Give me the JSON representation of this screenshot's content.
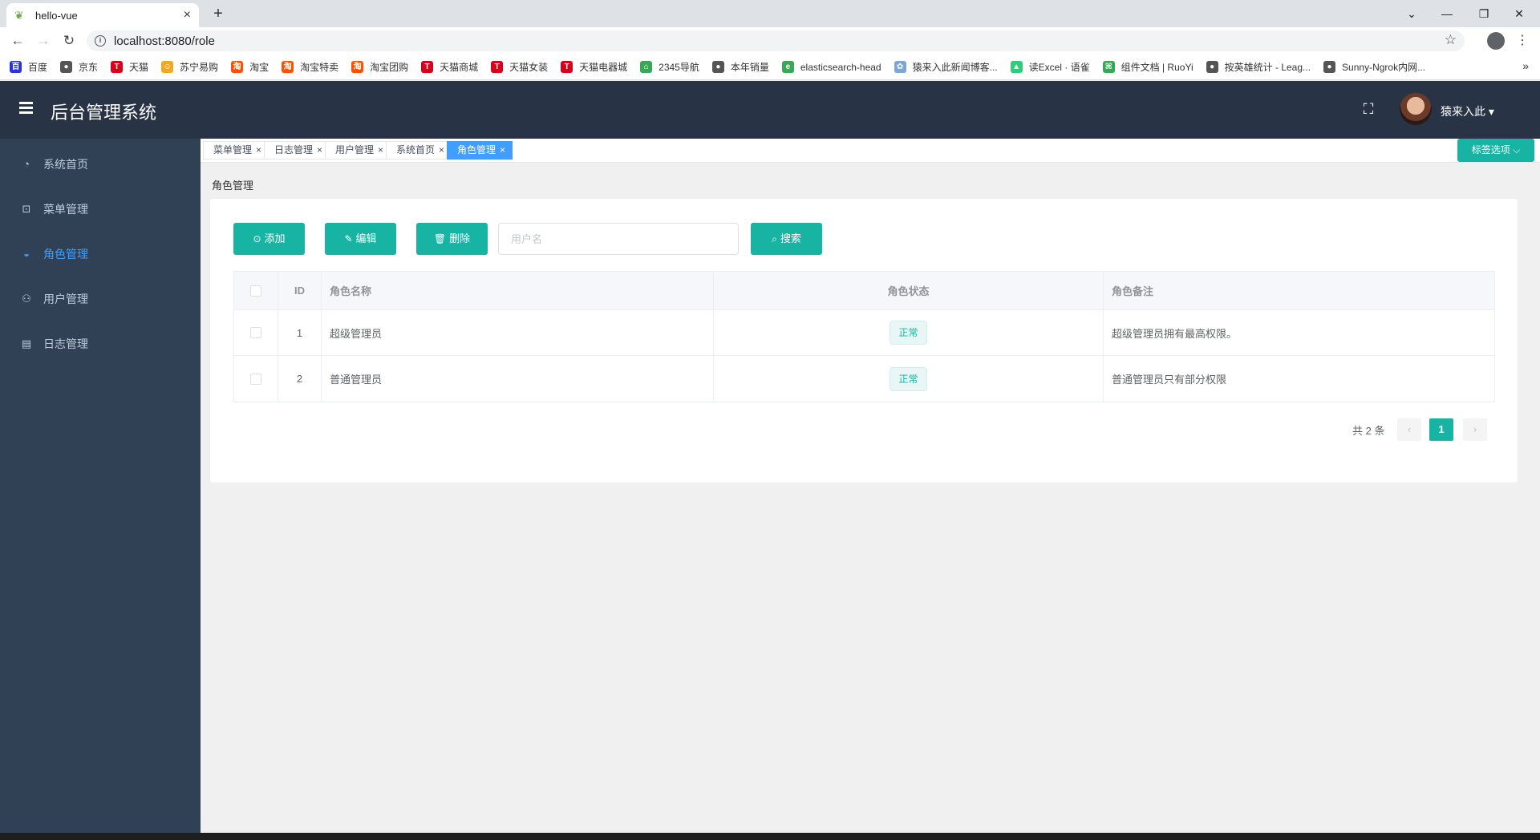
{
  "browser": {
    "tab_title": "hello-vue",
    "url": "localhost:8080/role",
    "bookmarks": [
      {
        "label": "百度",
        "color": "#2932e1",
        "glyph": "百"
      },
      {
        "label": "京东",
        "color": "#555555",
        "glyph": "●"
      },
      {
        "label": "天猫",
        "color": "#d9001b",
        "glyph": "T"
      },
      {
        "label": "苏宁易购",
        "color": "#f5a623",
        "glyph": "☺"
      },
      {
        "label": "淘宝",
        "color": "#ff5000",
        "glyph": "淘"
      },
      {
        "label": "淘宝特卖",
        "color": "#ff5000",
        "glyph": "淘"
      },
      {
        "label": "淘宝团购",
        "color": "#ff5000",
        "glyph": "淘"
      },
      {
        "label": "天猫商城",
        "color": "#d9001b",
        "glyph": "T"
      },
      {
        "label": "天猫女装",
        "color": "#d9001b",
        "glyph": "T"
      },
      {
        "label": "天猫电器城",
        "color": "#d9001b",
        "glyph": "T"
      },
      {
        "label": "2345导航",
        "color": "#3aa757",
        "glyph": "⌂"
      },
      {
        "label": "本年销量",
        "color": "#555555",
        "glyph": "●"
      },
      {
        "label": "elasticsearch-head",
        "color": "#3aa757",
        "glyph": "e"
      },
      {
        "label": "猿来入此新闻博客...",
        "color": "#7aa7d9",
        "glyph": "✿"
      },
      {
        "label": "读Excel · 语雀",
        "color": "#31cc79",
        "glyph": "▲"
      },
      {
        "label": "组件文档 | RuoYi",
        "color": "#3aa757",
        "glyph": "⌘"
      },
      {
        "label": "按英雄统计 - Leag...",
        "color": "#555555",
        "glyph": "●"
      },
      {
        "label": "Sunny-Ngrok内网...",
        "color": "#555555",
        "glyph": "●"
      }
    ],
    "more": "»"
  },
  "app": {
    "title": "后台管理系统",
    "username": "猿来入此 ▾"
  },
  "sidebar": {
    "items": [
      {
        "label": "系统首页",
        "icon": "speedometer-icon",
        "glyph": "◔",
        "active": false
      },
      {
        "label": "菜单管理",
        "icon": "cart-icon",
        "glyph": "⊡",
        "active": false
      },
      {
        "label": "角色管理",
        "icon": "dish-icon",
        "glyph": "◒",
        "active": true
      },
      {
        "label": "用户管理",
        "icon": "user-icon",
        "glyph": "⚇",
        "active": false
      },
      {
        "label": "日志管理",
        "icon": "clipboard-icon",
        "glyph": "▤",
        "active": false
      }
    ]
  },
  "tags": {
    "items": [
      {
        "label": "菜单管理",
        "active": false
      },
      {
        "label": "日志管理",
        "active": false
      },
      {
        "label": "用户管理",
        "active": false
      },
      {
        "label": "系统首页",
        "active": false
      },
      {
        "label": "角色管理",
        "active": true
      }
    ],
    "close": "×",
    "options_label": "标签选项 ⌵"
  },
  "breadcrumb": "角色管理",
  "toolbar": {
    "add_label": "添加",
    "edit_label": "编辑",
    "delete_label": "删除",
    "search_placeholder": "用户名",
    "search_value": "",
    "search_label": "搜索"
  },
  "table": {
    "columns": [
      "ID",
      "角色名称",
      "角色状态",
      "角色备注"
    ],
    "rows": [
      {
        "id": "1",
        "name": "超级管理员",
        "status": "正常",
        "remark": "超级管理员拥有最高权限。"
      },
      {
        "id": "2",
        "name": "普通管理员",
        "status": "正常",
        "remark": "普通管理员只有部分权限"
      }
    ]
  },
  "pagination": {
    "total_text": "共 2 条",
    "current": "1",
    "prev": "‹",
    "next": "›"
  },
  "colors": {
    "accent": "#17b3a3",
    "sidebar_bg": "#304156",
    "header_bg": "#283446",
    "active_blue": "#409eff"
  }
}
